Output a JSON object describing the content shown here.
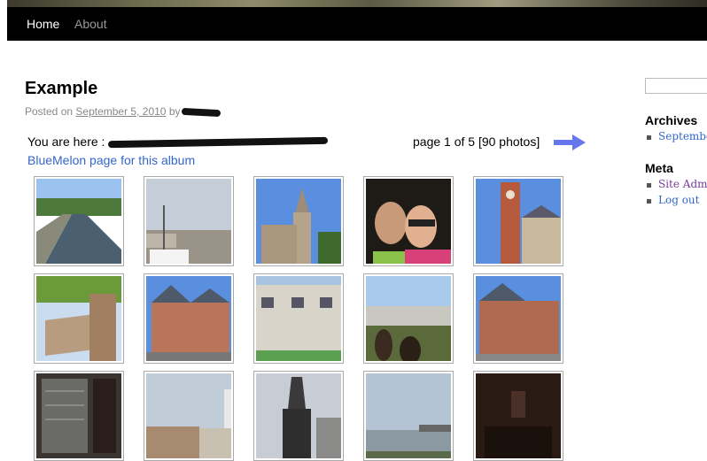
{
  "nav": {
    "home": "Home",
    "about": "About"
  },
  "post": {
    "title": "Example",
    "posted_on": "Posted on",
    "date": "September 5, 2010",
    "by": "by"
  },
  "breadcrumb": {
    "you_are_here": "You are here :"
  },
  "pagination": {
    "text": "page 1 of 5 [90 photos]"
  },
  "album_link": "BlueMelon page for this album",
  "sidebar": {
    "archives_title": "Archives",
    "archives": [
      "September"
    ],
    "meta_title": "Meta",
    "meta_links": [
      "Site Admin",
      "Log out"
    ]
  },
  "photos": [
    {
      "scene": "canal"
    },
    {
      "scene": "street-van"
    },
    {
      "scene": "church"
    },
    {
      "scene": "two-women"
    },
    {
      "scene": "belfry"
    },
    {
      "scene": "tilted-building"
    },
    {
      "scene": "town-hall"
    },
    {
      "scene": "shops"
    },
    {
      "scene": "crowd"
    },
    {
      "scene": "town-hall-2"
    },
    {
      "scene": "dark-plaque"
    },
    {
      "scene": "lighthouse"
    },
    {
      "scene": "tower-silhouette"
    },
    {
      "scene": "harbour"
    },
    {
      "scene": "dark-interior"
    }
  ],
  "colors": {
    "link": "#3366cc",
    "nav_bg": "#000000",
    "arrow": "#6677ee"
  }
}
